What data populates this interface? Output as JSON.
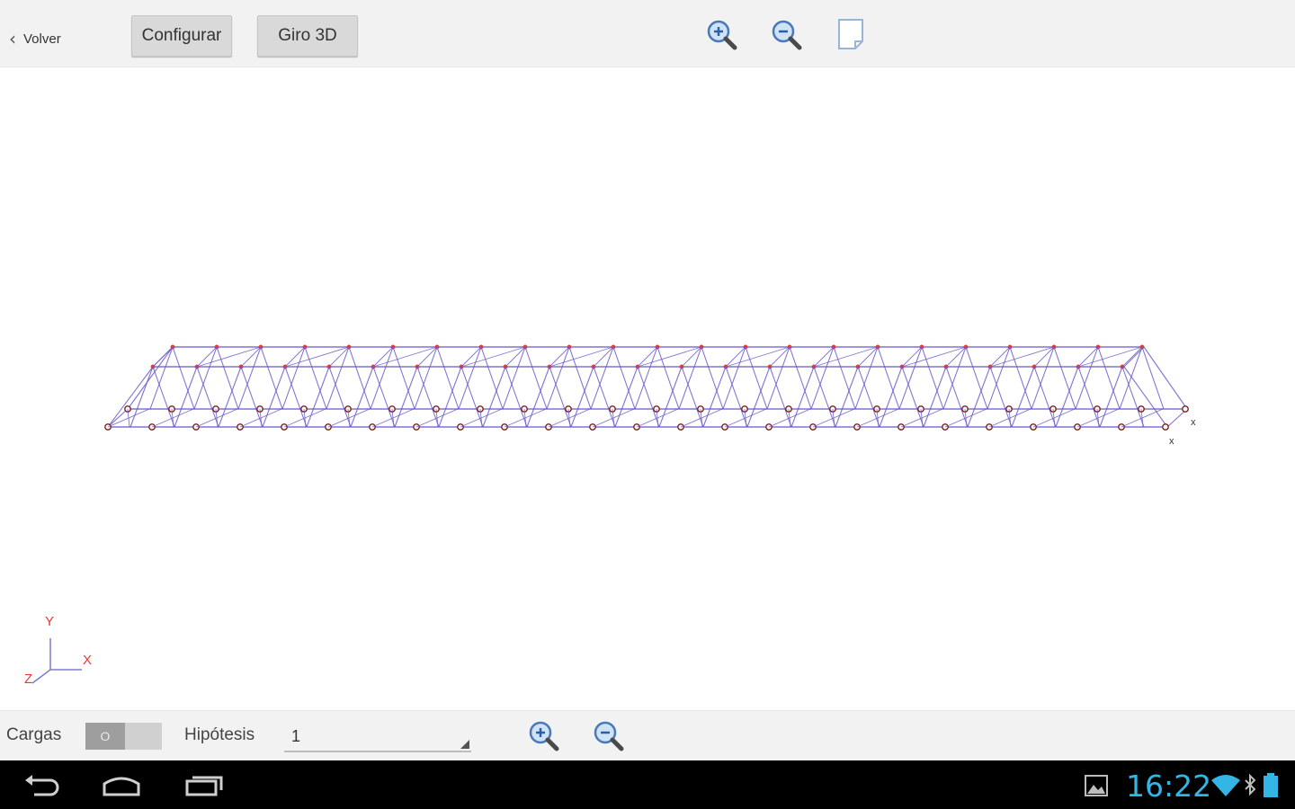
{
  "toolbar": {
    "back_label": "Volver",
    "configure_label": "Configurar",
    "rotate_label": "Giro 3D"
  },
  "axes": {
    "x": "X",
    "y": "Y",
    "z": "Z",
    "marker": "x"
  },
  "bottom": {
    "loads_label": "Cargas",
    "loads_toggle_text": "O",
    "hypothesis_label": "Hipótesis",
    "hypothesis_value": "1"
  },
  "status": {
    "time": "16:22"
  },
  "colors": {
    "truss_line": "#6a5acd",
    "node": "#e53935",
    "accent_blue": "#33b5e5"
  },
  "icons": [
    "zoom-in-icon",
    "zoom-out-icon",
    "page-icon",
    "back-nav-icon",
    "home-nav-icon",
    "recent-apps-icon",
    "gallery-icon",
    "wifi-icon",
    "bluetooth-icon",
    "battery-icon"
  ]
}
